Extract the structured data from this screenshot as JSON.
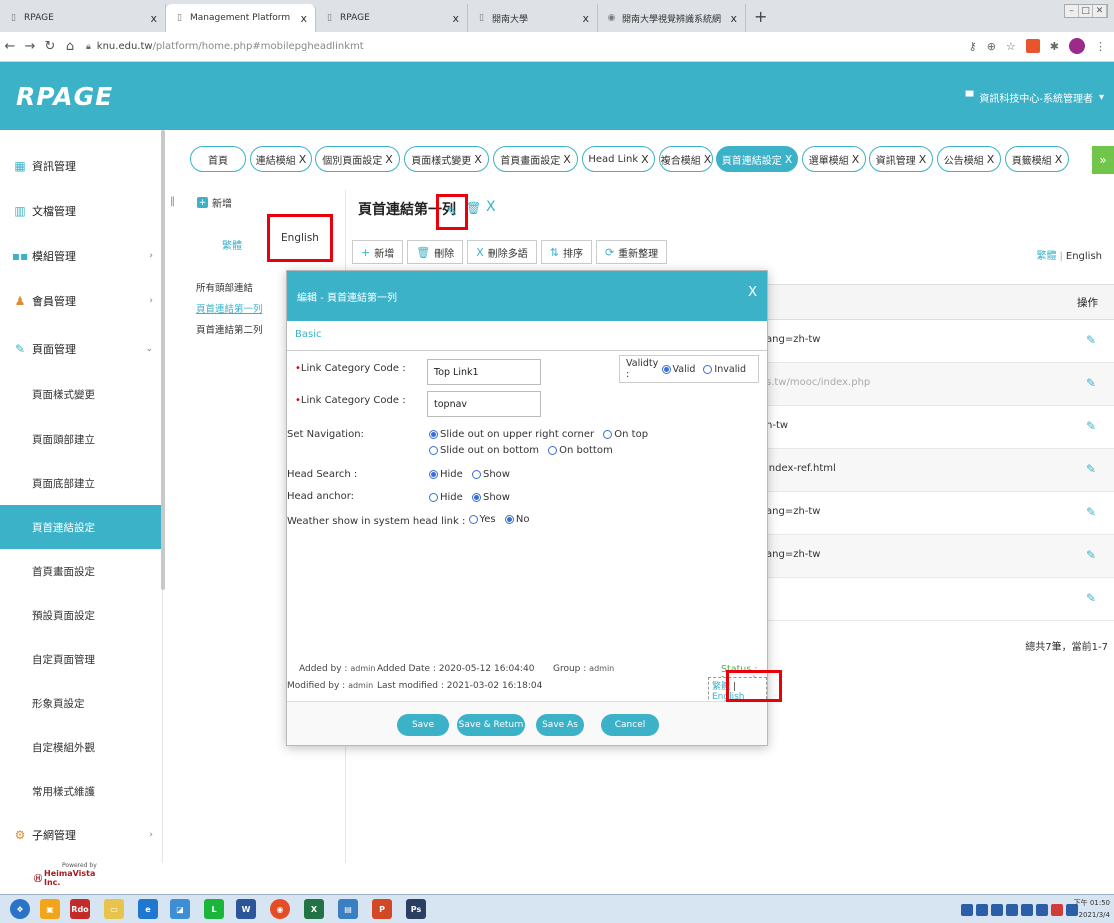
{
  "browser": {
    "tabs": [
      {
        "title": "RPAGE",
        "close": "x"
      },
      {
        "title": "Management Platform",
        "close": "x"
      },
      {
        "title": "RPAGE",
        "close": "x"
      },
      {
        "title": "開南大學",
        "close": "x"
      },
      {
        "title": "開南大學視覺辨識系統網",
        "close": "x"
      }
    ],
    "new_tab": "+",
    "url_host": "knu.edu.tw",
    "url_path": "/platform/home.php#mobilepgheadlinkmt"
  },
  "app": {
    "logo": "RPAGE",
    "user": "資訊科技中心-系統管理者"
  },
  "sidebar": {
    "items": [
      {
        "label": "資訊管理",
        "icon": "grid-icon",
        "chevron": ""
      },
      {
        "label": "文檔管理",
        "icon": "bar-chart-icon",
        "chevron": ""
      },
      {
        "label": "模組管理",
        "icon": "modules-icon",
        "chevron": "›"
      },
      {
        "label": "會員管理",
        "icon": "users-icon",
        "chevron": "›"
      },
      {
        "label": "頁面管理",
        "icon": "edit-icon",
        "chevron": "⌄"
      }
    ],
    "subitems": [
      "頁面樣式變更",
      "頁面頭部建立",
      "頁面底部建立",
      "頁首連結設定",
      "首頁畫面設定",
      "預設頁面設定",
      "自定頁面管理",
      "形象頁設定",
      "自定模組外觀",
      "常用樣式維護"
    ],
    "last_item": {
      "label": "子網管理",
      "chevron": "›"
    },
    "powered_top": "Powered by",
    "powered_brand": "HeimaVista Inc."
  },
  "page_tabs": [
    {
      "label": "首頁",
      "close": ""
    },
    {
      "label": "連結模組",
      "close": "X"
    },
    {
      "label": "個別頁面設定",
      "close": "X"
    },
    {
      "label": "頁面樣式變更",
      "close": "X"
    },
    {
      "label": "首頁畫面設定",
      "close": "X"
    },
    {
      "label": "Head Link",
      "close": "X"
    },
    {
      "label": "複合模組",
      "close": "X"
    },
    {
      "label": "頁首連結設定",
      "close": "X"
    },
    {
      "label": "選單模組",
      "close": "X"
    },
    {
      "label": "資訊管理",
      "close": "X"
    },
    {
      "label": "公告模組",
      "close": "X"
    },
    {
      "label": "頁籤模組",
      "close": "X"
    }
  ],
  "tab_next": "»",
  "tree": {
    "add_label": "新增",
    "lang_trad": "繁體",
    "lang_eng": "English",
    "items": [
      "所有頭部連結",
      "頁首連結第一列",
      "頁首連結第二列"
    ]
  },
  "panel": {
    "title": "頁首連結第一列",
    "title_close": "X",
    "toolbar": [
      {
        "icon": "add-icon",
        "glyph": "+",
        "label": "新增"
      },
      {
        "icon": "trash-icon",
        "glyph": "🗑",
        "label": "刪除"
      },
      {
        "icon": "multi-delete-icon",
        "glyph": "X",
        "label": "刪除多語"
      },
      {
        "icon": "sort-icon",
        "glyph": "⇅",
        "label": "排序"
      },
      {
        "icon": "refresh-icon",
        "glyph": "⟳",
        "label": "重新整理"
      }
    ],
    "lang_tw": "繁體",
    "lang_sep": "|",
    "lang_en": "English",
    "op_header": "操作",
    "rows": [
      {
        "value": "ang=zh-tw",
        "gray": false
      },
      {
        "value": "s.tw/mooc/index.php",
        "gray": true
      },
      {
        "value": "h-tw",
        "gray": false
      },
      {
        "value": "index-ref.html",
        "gray": false
      },
      {
        "value": "ang=zh-tw",
        "gray": false
      },
      {
        "value": "ang=zh-tw",
        "gray": false
      },
      {
        "value": "",
        "gray": false
      }
    ],
    "summary": "總共7筆，當前1-7"
  },
  "modal": {
    "title": "編輯 - 頁首連結第一列",
    "close": "X",
    "tab": "Basic",
    "field1_label": "Link Category Code :",
    "field1_value": "Top Link1",
    "field2_label": "Link Category Code :",
    "field2_value": "topnav",
    "validity_label": "Validty :",
    "validity_valid": "Valid",
    "validity_invalid": "Invalid",
    "nav_label": "Set Navigation:",
    "nav_opt1": "Slide out on upper right corner",
    "nav_opt2": "On top",
    "nav_opt3": "Slide out on bottom",
    "nav_opt4": "On bottom",
    "search_label": "Head Search :",
    "search_hide": "Hide",
    "search_show": "Show",
    "anchor_label": "Head anchor:",
    "anchor_hide": "Hide",
    "anchor_show": "Show",
    "weather_label": "Weather show in system head link :",
    "weather_yes": "Yes",
    "weather_no": "No",
    "added_by_label": "Added by :",
    "added_by": "admin",
    "added_date_label": "Added Date :",
    "added_date": "2020-05-12 16:04:40",
    "group_label": "Group :",
    "group": "admin",
    "modified_by_label": "Modified by :",
    "modified_by": "admin",
    "last_modified_label": "Last modified :",
    "last_modified": "2021-03-02 16:18:04",
    "status": "Status : Normal",
    "lang_tw": "繁體",
    "lang_en": "English",
    "buttons": [
      "Save",
      "Save & Return",
      "Save As",
      "Cancel"
    ]
  },
  "taskbar": {
    "apps": [
      "Rdo",
      "W",
      "X",
      "P",
      "Ps"
    ],
    "time": "下午 01:50",
    "date": "2021/3/4"
  }
}
